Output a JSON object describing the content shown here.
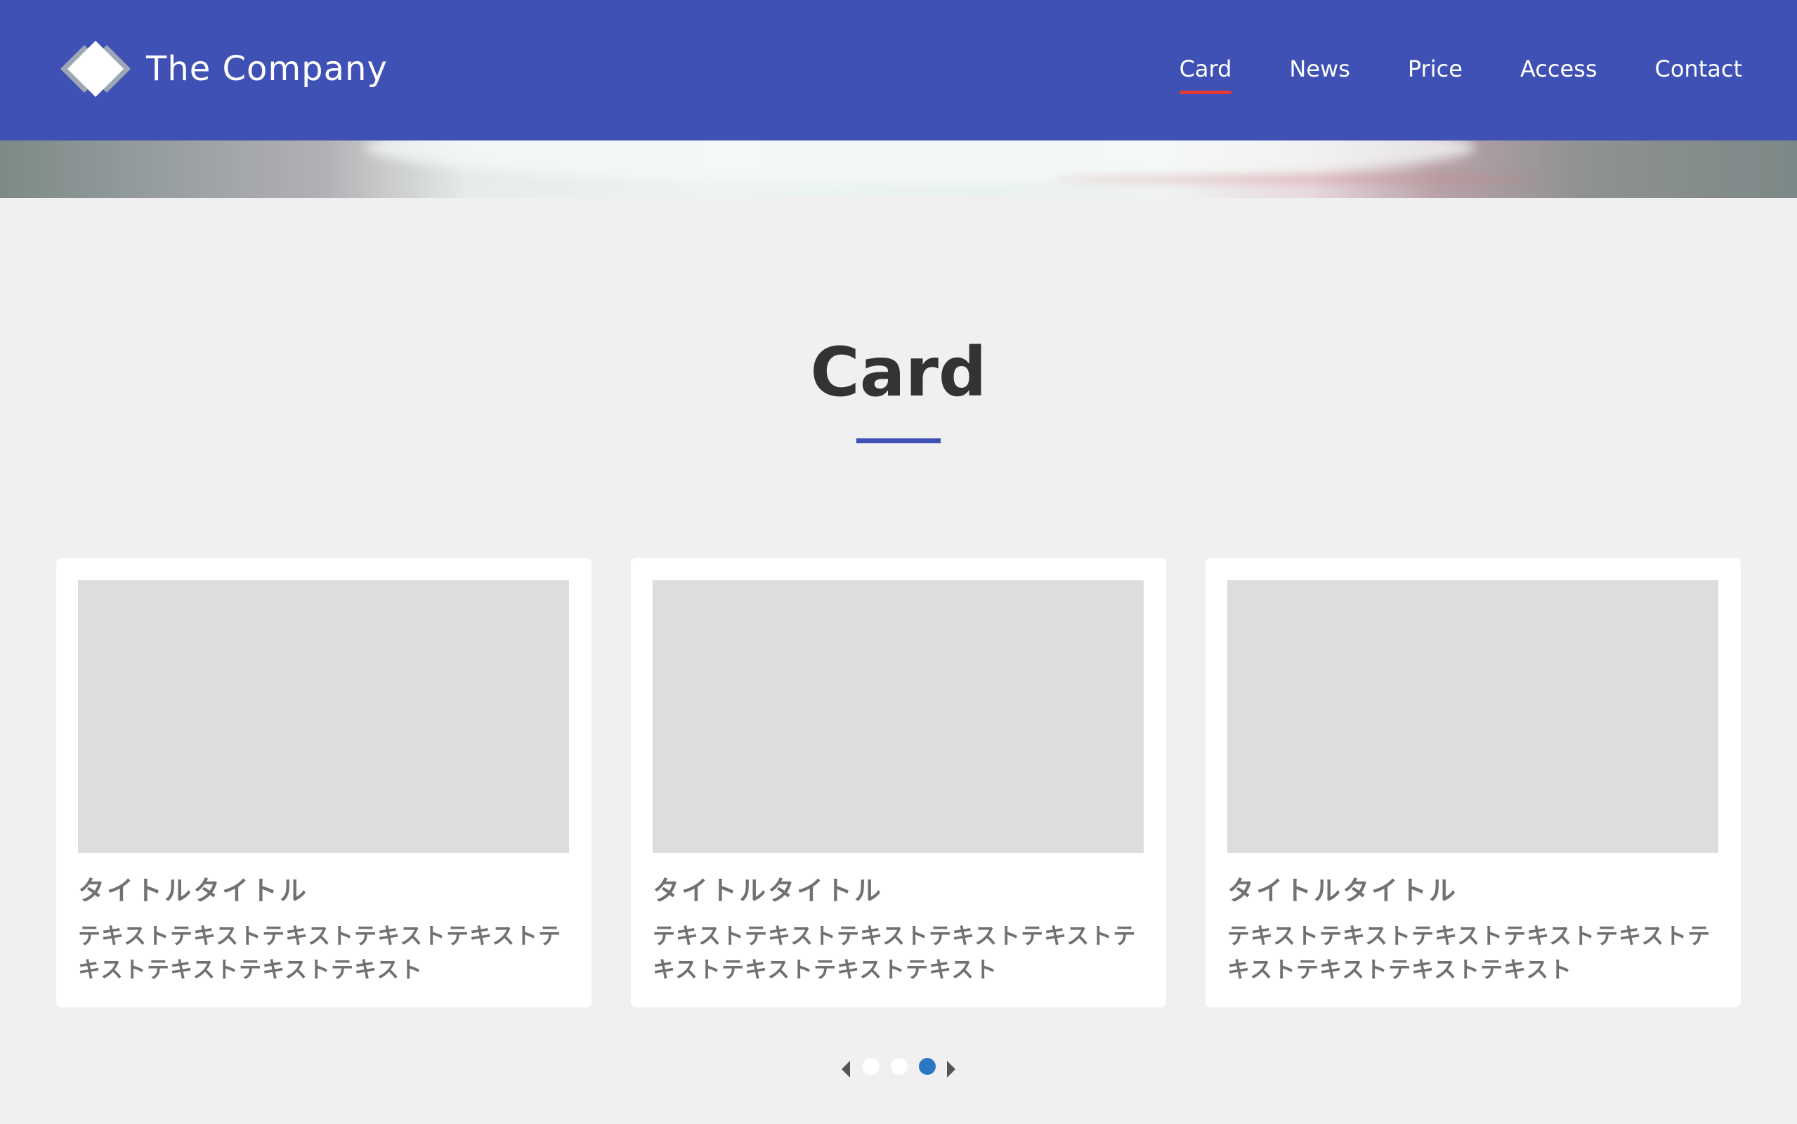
{
  "header": {
    "logo_text": "The Company",
    "background_color": "#3f51b5",
    "nav": [
      {
        "label": "Card",
        "active": true
      },
      {
        "label": "News",
        "active": false
      },
      {
        "label": "Price",
        "active": false
      },
      {
        "label": "Access",
        "active": false
      },
      {
        "label": "Contact",
        "active": false
      }
    ],
    "active_indicator_color": "#e53935"
  },
  "section": {
    "title": "Card",
    "underline_color": "#3f51b5"
  },
  "cards": [
    {
      "title": "タイトルタイトル",
      "text": "テキストテキストテキストテキストテキストテキストテキストテキストテキスト"
    },
    {
      "title": "タイトルタイトル",
      "text": "テキストテキストテキストテキストテキストテキストテキストテキストテキスト"
    },
    {
      "title": "タイトルタイトル",
      "text": "テキストテキストテキストテキストテキストテキストテキストテキストテキスト"
    }
  ],
  "pagination": {
    "pages": 3,
    "current_page": 3,
    "active_color": "#2b77c4",
    "prev_icon": "chevron-left-icon",
    "next_icon": "chevron-right-icon"
  }
}
